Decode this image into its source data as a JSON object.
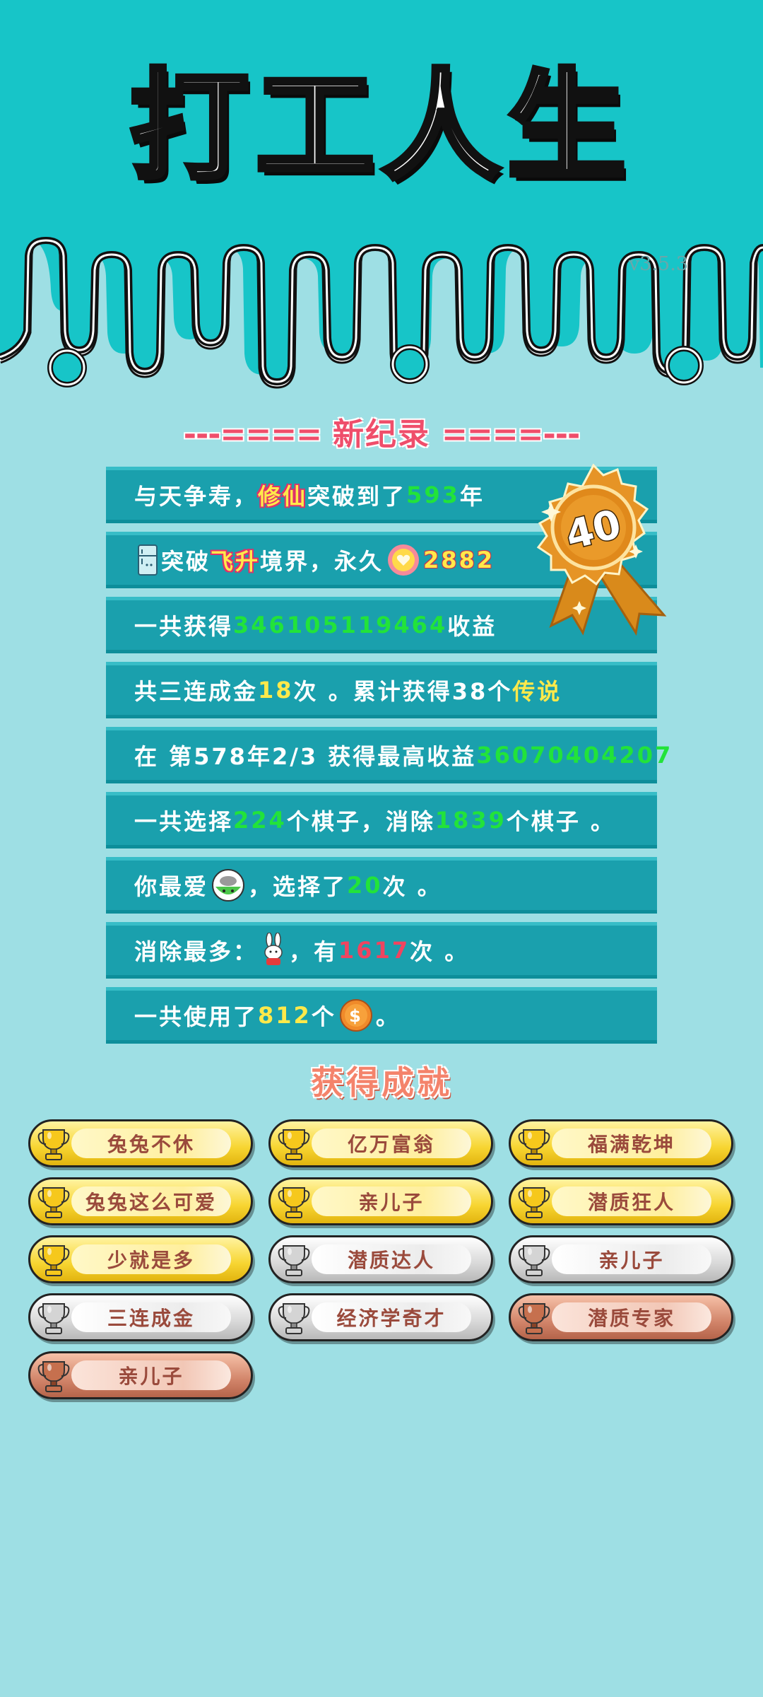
{
  "header": {
    "title": "打工人生",
    "version": "v3.5.3",
    "bg_color": "#17c5c8"
  },
  "record": {
    "heading": "新纪录",
    "dashes_left": "---====",
    "dashes_right": "====---",
    "medal_value": "40",
    "rows": [
      {
        "p1": "与天争寿，",
        "h1": "修仙",
        "p2": "突破到了",
        "n1": "593",
        "p3": "年"
      },
      {
        "icon": "fridge-icon",
        "p1": "突破",
        "h1": "飞升",
        "p2": "境界，永久",
        "icon2": "heart-coin-icon",
        "n1": "2882"
      },
      {
        "p1": "一共获得",
        "n1": "346105119464",
        "p2": "收益"
      },
      {
        "p1": "共三连成金",
        "n1": "18",
        "p2": "次 。累计获得38个",
        "h1": "传说"
      },
      {
        "p1": "在 第578年2/3 获得最高收益",
        "n1": "36070404207"
      },
      {
        "p1": "一共选择",
        "n1": "224",
        "p2": "个棋子，消除",
        "n2": "1839",
        "p3": "个棋子 。"
      },
      {
        "p1": "你最爱",
        "icon": "bowl-icon",
        "p2": "，选择了",
        "n1": "20",
        "p3": "次 。"
      },
      {
        "p1": "消除最多：",
        "icon": "rabbit-icon",
        "p2": "，有",
        "n1": "1617",
        "p3": "次 。"
      },
      {
        "p1": "一共使用了",
        "n1": "812",
        "p2": "个",
        "icon": "coin-icon",
        "p3": " 。"
      }
    ]
  },
  "achievements": {
    "heading": "获得成就",
    "items": [
      {
        "label": "兔兔不休",
        "tier": "gold"
      },
      {
        "label": "亿万富翁",
        "tier": "gold"
      },
      {
        "label": "福满乾坤",
        "tier": "gold"
      },
      {
        "label": "兔兔这么可爱",
        "tier": "gold"
      },
      {
        "label": "亲儿子",
        "tier": "gold"
      },
      {
        "label": "潜质狂人",
        "tier": "gold"
      },
      {
        "label": "少就是多",
        "tier": "gold"
      },
      {
        "label": "潜质达人",
        "tier": "silver"
      },
      {
        "label": "亲儿子",
        "tier": "silver"
      },
      {
        "label": "三连成金",
        "tier": "silver"
      },
      {
        "label": "经济学奇才",
        "tier": "silver"
      },
      {
        "label": "潜质专家",
        "tier": "bronze"
      },
      {
        "label": "亲儿子",
        "tier": "bronze"
      }
    ]
  },
  "colors": {
    "background": "#9edfe4",
    "row": "#1aa0ad",
    "green_number": "#22e33a",
    "yellow_number": "#ffe94a",
    "red_number": "#f0445f",
    "heading_red": "#ef4e6b"
  }
}
